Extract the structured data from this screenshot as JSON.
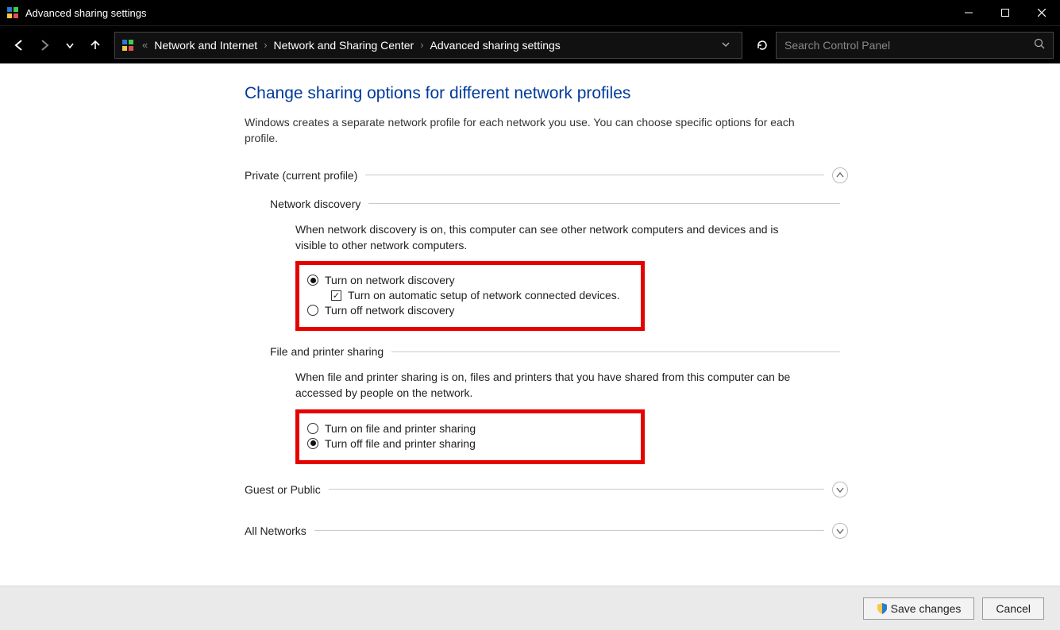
{
  "titlebar": {
    "title": "Advanced sharing settings"
  },
  "breadcrumb": {
    "prefix": "«",
    "segments": [
      "Network and Internet",
      "Network and Sharing Center",
      "Advanced sharing settings"
    ]
  },
  "search": {
    "placeholder": "Search Control Panel"
  },
  "page": {
    "title": "Change sharing options for different network profiles",
    "description": "Windows creates a separate network profile for each network you use. You can choose specific options for each profile."
  },
  "private_section": {
    "title": "Private (current profile)"
  },
  "network_discovery": {
    "title": "Network discovery",
    "desc": "When network discovery is on, this computer can see other network computers and devices and is visible to other network computers.",
    "opt_on": "Turn on network discovery",
    "opt_auto": "Turn on automatic setup of network connected devices.",
    "opt_off": "Turn off network discovery"
  },
  "file_printer": {
    "title": "File and printer sharing",
    "desc": "When file and printer sharing is on, files and printers that you have shared from this computer can be accessed by people on the network.",
    "opt_on": "Turn on file and printer sharing",
    "opt_off": "Turn off file and printer sharing"
  },
  "guest_section": {
    "title": "Guest or Public"
  },
  "all_section": {
    "title": "All Networks"
  },
  "buttons": {
    "save": "Save changes",
    "cancel": "Cancel"
  }
}
